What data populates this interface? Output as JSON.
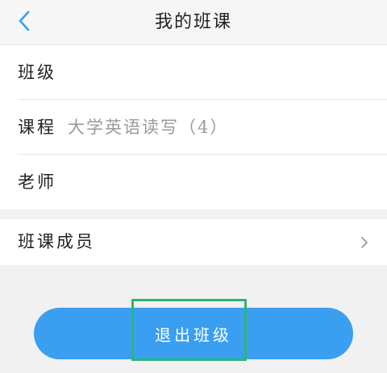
{
  "header": {
    "title": "我的班课",
    "back_icon": "chevron-left-icon",
    "accent_color": "#3a9ff1"
  },
  "info": {
    "class_label": "班级",
    "class_value": "",
    "course_label": "课程",
    "course_value": "大学英语读写（4）",
    "teacher_label": "老师",
    "teacher_value": ""
  },
  "members": {
    "label": "班课成员",
    "icon": "chevron-right-icon"
  },
  "actions": {
    "quit_label": "退出班级",
    "quit_color": "#3a9ff1",
    "highlight_color": "#2bb673"
  }
}
